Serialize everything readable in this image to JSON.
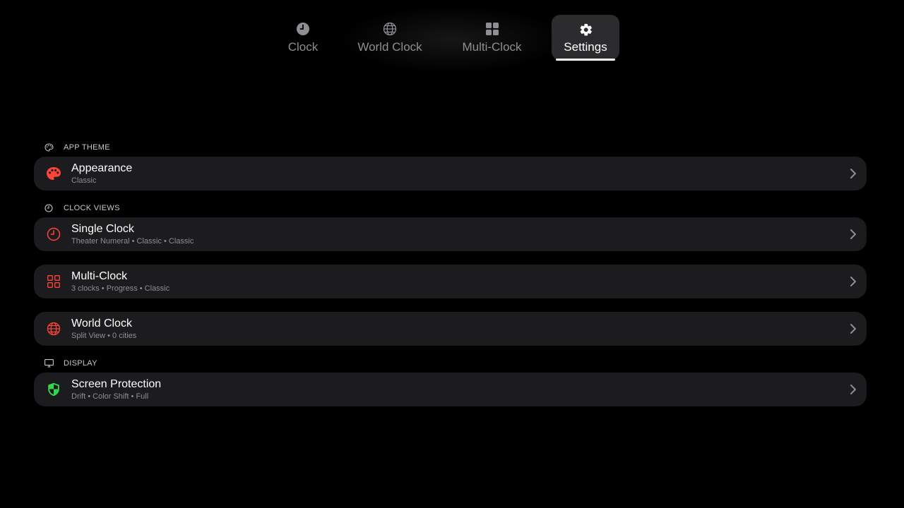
{
  "tabs": [
    {
      "label": "Clock",
      "icon": "clock-icon",
      "active": false
    },
    {
      "label": "World Clock",
      "icon": "globe-icon",
      "active": false
    },
    {
      "label": "Multi-Clock",
      "icon": "grid-icon",
      "active": false
    },
    {
      "label": "Settings",
      "icon": "gear-icon",
      "active": true
    }
  ],
  "sections": {
    "app_theme": {
      "header": "APP THEME",
      "icon": "palette-icon",
      "rows": [
        {
          "title": "Appearance",
          "subtitle": "Classic",
          "icon": "palette-icon"
        }
      ]
    },
    "clock_views": {
      "header": "CLOCK VIEWS",
      "icon": "clock-icon",
      "rows": [
        {
          "title": "Single Clock",
          "subtitle": "Theater Numeral • Classic • Classic",
          "icon": "clock-icon"
        },
        {
          "title": "Multi-Clock",
          "subtitle": "3 clocks • Progress • Classic",
          "icon": "grid-icon"
        },
        {
          "title": "World Clock",
          "subtitle": "Split View • 0 cities",
          "icon": "globe-icon"
        }
      ]
    },
    "display": {
      "header": "DISPLAY",
      "icon": "display-icon",
      "rows": [
        {
          "title": "Screen Protection",
          "subtitle": "Drift • Color Shift • Full",
          "icon": "shield-icon"
        }
      ]
    }
  },
  "colors": {
    "accent_red": "#ff453a",
    "accent_green": "#32d74b",
    "row_background": "#1c1c1e",
    "tab_active_background": "#2c2c2e",
    "secondary_text": "#8e8e93"
  }
}
